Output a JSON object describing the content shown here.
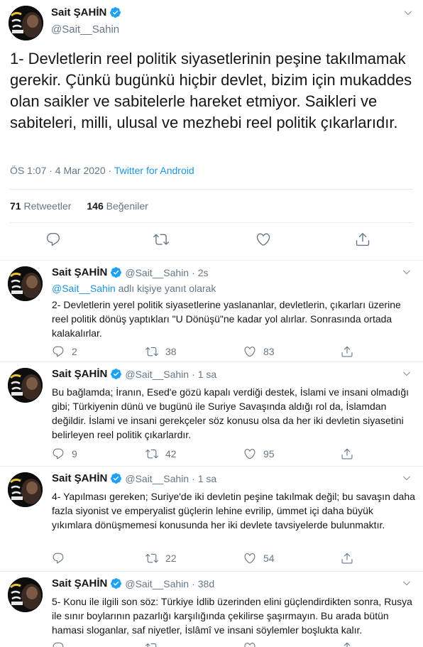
{
  "main": {
    "name": "Sait ŞAHİN",
    "handle": "@Sait__Sahin",
    "text": "1- Devletlerin reel politik siyasetlerinin peşine takılmamak gerekir. Çünkü bugünkü hiçbir devlet, bizim için mukaddes olan saikler ve sabitelerle hareket etmiyor. Saikleri ve sabiteleri, milli, ulusal ve mezhebi reel politik çıkarlarıdır.",
    "time": "ÖS 1:07 · 4 Mar 2020 · ",
    "client": "Twitter for Android",
    "retweets_count": "71",
    "retweets_label": "Retweetler",
    "likes_count": "146",
    "likes_label": "Beğeniler"
  },
  "replies": [
    {
      "name": "Sait ŞAHİN",
      "handle": "@Sait__Sahin",
      "time": "2s",
      "replying_to": "@Sait__Sahin",
      "replying_suffix": " adlı kişiye yanıt olarak",
      "text": "2- Devletlerin yerel politik siyasetlerine yaslananlar, devletlerin, çıkarları üzerine reel politik dönüş yaptıkları \"U Dönüşü\"ne kadar yol alırlar. Sonrasında ortada kalakalırlar.",
      "replies": "2",
      "retweets": "38",
      "likes": "83"
    },
    {
      "name": "Sait ŞAHİN",
      "handle": "@Sait__Sahin",
      "time": "1 sa",
      "text": "Bu bağlamda; İranın, Esed'e gözü kapalı verdiği destek, İslami ve insani olmadığı gibi; Türkiyenin dünü ve bugünü ile Suriye Savaşında aldığı rol da, İslamdan değildir. İslami ve insani gerekçeler söz konusu olsa da her iki devletin siyasetini belirleyen reel politik çıkarlardır.",
      "replies": "9",
      "retweets": "42",
      "likes": "95"
    },
    {
      "name": "Sait ŞAHİN",
      "handle": "@Sait__Sahin",
      "time": "1 sa",
      "text": "4- Yapılması gereken; Suriye'de iki devletin peşine takılmak değil; bu savaşın daha fazla siyonist ve emperyalist güçlerin lehine evrilip, ümmet içi daha büyük yıkımlara  dönüşmemesi konusunda her iki devlete tavsiyelerde bulunmaktır.",
      "replies": "",
      "retweets": "22",
      "likes": "54"
    },
    {
      "name": "Sait ŞAHİN",
      "handle": "@Sait__Sahin",
      "time": "38d",
      "text": "5- Konu ile ilgili son söz: Türkiye İdlib üzerinden elini güçlendirdikten sonra, Rusya ile sınır boylarının pazarlığı karşılığında çekilirse şaşırmayın. Bu arada bütün hamasi sloganlar, saf niyetler, İslâmî ve insani söylemler boşlukta kalır.",
      "replies": "",
      "retweets": "",
      "likes": ""
    }
  ],
  "colors": {
    "accent": "#1da1f2",
    "link": "#1b95e0",
    "muted": "#657786",
    "text": "#14171a",
    "border": "#e6ecf0"
  },
  "icons": [
    "verified-icon",
    "chevron-down-icon",
    "reply-icon",
    "retweet-icon",
    "like-icon",
    "share-icon"
  ]
}
